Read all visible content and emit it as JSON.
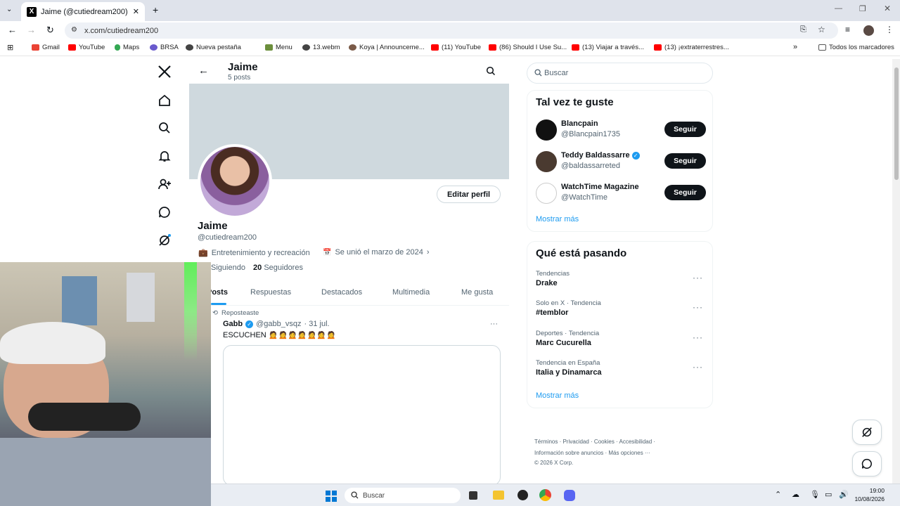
{
  "browser": {
    "tab_title": "Jaime (@cutiedream200) / X",
    "url": "x.com/cutiedream200",
    "bookmarks": [
      "Gmail",
      "YouTube",
      "Maps",
      "BRSA",
      "Nueva pestaña",
      "Menu",
      "13.webm",
      "Koya | Announceme...",
      "(11) YouTube",
      "(86) Should I Use Su...",
      "(13) Viajar a través...",
      "(13) ¡extraterrestres..."
    ],
    "all_bookmarks": "Todos los marcadores"
  },
  "header": {
    "name": "Jaime",
    "posts": "5 posts"
  },
  "profile": {
    "edit_label": "Editar perfil",
    "name": "Jaime",
    "handle": "@cutiedream200",
    "category": "Entretenimiento y recreación",
    "joined": "Se unió el marzo de 2024",
    "following_label": "Siguiendo",
    "followers_count": "20",
    "followers_label": "Seguidores"
  },
  "tabs": [
    "Posts",
    "Respuestas",
    "Destacados",
    "Multimedia",
    "Me gusta"
  ],
  "post": {
    "repost_label": "Reposteaste",
    "author": "Gabb",
    "handle": "@gabb_vsqz",
    "date": "· 31 jul.",
    "text": "ESCUCHEN 🙍🙍🙍🙍🙍🙍🙍",
    "more": "···"
  },
  "search": {
    "placeholder": "Buscar"
  },
  "suggestions": {
    "title": "Tal vez te guste",
    "follow_label": "Seguir",
    "items": [
      {
        "name": "Blancpain",
        "handle": "@Blancpain1735",
        "verified": false
      },
      {
        "name": "Teddy Baldassarre",
        "handle": "@baldassarreted",
        "verified": true
      },
      {
        "name": "WatchTime Magazine",
        "handle": "@WatchTime",
        "verified": false
      }
    ],
    "show_more": "Mostrar más"
  },
  "trends": {
    "title": "Qué está pasando",
    "items": [
      {
        "context": "Tendencias",
        "topic": "Drake"
      },
      {
        "context": "Solo en X · Tendencia",
        "topic": "#temblor"
      },
      {
        "context": "Deportes · Tendencia",
        "topic": "Marc Cucurella"
      },
      {
        "context": "Tendencia en España",
        "topic": "Italia y Dinamarca"
      }
    ],
    "show_more": "Mostrar más"
  },
  "footer": {
    "line1": "Términos   ·   Privacidad   ·   Cookies   ·   Accesibilidad   ·",
    "line2": "Información sobre anuncios   ·   Más opciones ···",
    "line3": "© 2026 X Corp."
  },
  "taskbar": {
    "search": "Buscar",
    "time": "19:00",
    "date": "10/08/2026"
  }
}
